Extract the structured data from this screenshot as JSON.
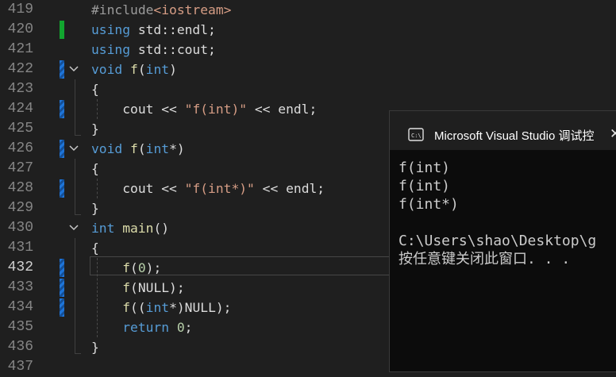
{
  "editor": {
    "lines": [
      {
        "num": "419",
        "tokens": [
          {
            "t": "#include",
            "c": "pp"
          },
          {
            "t": "<iostream>",
            "c": "inc"
          }
        ]
      },
      {
        "num": "420",
        "tokens": [
          {
            "t": "using",
            "c": "kw"
          },
          {
            "t": " std::endl;",
            "c": "plain"
          }
        ]
      },
      {
        "num": "421",
        "tokens": [
          {
            "t": "using",
            "c": "kw"
          },
          {
            "t": " std::cout;",
            "c": "plain"
          }
        ]
      },
      {
        "num": "422",
        "tokens": [
          {
            "t": "void",
            "c": "kw"
          },
          {
            "t": " ",
            "c": "plain"
          },
          {
            "t": "f",
            "c": "fn"
          },
          {
            "t": "(",
            "c": "plain"
          },
          {
            "t": "int",
            "c": "kw"
          },
          {
            "t": ")",
            "c": "plain"
          }
        ]
      },
      {
        "num": "423",
        "tokens": [
          {
            "t": "{",
            "c": "plain"
          }
        ]
      },
      {
        "num": "424",
        "tokens": [
          {
            "t": "    cout << ",
            "c": "plain"
          },
          {
            "t": "\"f(int)\"",
            "c": "str"
          },
          {
            "t": " << endl;",
            "c": "plain"
          }
        ]
      },
      {
        "num": "425",
        "tokens": [
          {
            "t": "}",
            "c": "plain"
          }
        ]
      },
      {
        "num": "426",
        "tokens": [
          {
            "t": "void",
            "c": "kw"
          },
          {
            "t": " ",
            "c": "plain"
          },
          {
            "t": "f",
            "c": "fn"
          },
          {
            "t": "(",
            "c": "plain"
          },
          {
            "t": "int",
            "c": "kw"
          },
          {
            "t": "*)",
            "c": "plain"
          }
        ]
      },
      {
        "num": "427",
        "tokens": [
          {
            "t": "{",
            "c": "plain"
          }
        ]
      },
      {
        "num": "428",
        "tokens": [
          {
            "t": "    cout << ",
            "c": "plain"
          },
          {
            "t": "\"f(int*)\"",
            "c": "str"
          },
          {
            "t": " << endl;",
            "c": "plain"
          }
        ]
      },
      {
        "num": "429",
        "tokens": [
          {
            "t": "}",
            "c": "plain"
          }
        ]
      },
      {
        "num": "430",
        "tokens": [
          {
            "t": "int",
            "c": "kw"
          },
          {
            "t": " ",
            "c": "plain"
          },
          {
            "t": "main",
            "c": "fn"
          },
          {
            "t": "()",
            "c": "plain"
          }
        ]
      },
      {
        "num": "431",
        "tokens": [
          {
            "t": "{",
            "c": "plain"
          }
        ]
      },
      {
        "num": "432",
        "tokens": [
          {
            "t": "    ",
            "c": "plain"
          },
          {
            "t": "f",
            "c": "fn"
          },
          {
            "t": "(",
            "c": "plain"
          },
          {
            "t": "0",
            "c": "num"
          },
          {
            "t": ");",
            "c": "plain"
          }
        ]
      },
      {
        "num": "433",
        "tokens": [
          {
            "t": "    ",
            "c": "plain"
          },
          {
            "t": "f",
            "c": "fn"
          },
          {
            "t": "(NULL);",
            "c": "plain"
          }
        ]
      },
      {
        "num": "434",
        "tokens": [
          {
            "t": "    ",
            "c": "plain"
          },
          {
            "t": "f",
            "c": "fn"
          },
          {
            "t": "((",
            "c": "plain"
          },
          {
            "t": "int",
            "c": "kw"
          },
          {
            "t": "*)NULL);",
            "c": "plain"
          }
        ]
      },
      {
        "num": "435",
        "tokens": [
          {
            "t": "    ",
            "c": "plain"
          },
          {
            "t": "return",
            "c": "kw"
          },
          {
            "t": " ",
            "c": "plain"
          },
          {
            "t": "0",
            "c": "num"
          },
          {
            "t": ";",
            "c": "plain"
          }
        ]
      },
      {
        "num": "436",
        "tokens": [
          {
            "t": "}",
            "c": "plain"
          }
        ]
      },
      {
        "num": "437",
        "tokens": []
      }
    ],
    "active_line": "432",
    "colors": {
      "background": "#1f1f1f",
      "keyword": "#569cd6",
      "function": "#dcdcaa",
      "string": "#d69d85",
      "number": "#b5cea8",
      "change_added": "#12a52f",
      "change_modified": "#1e74d8"
    }
  },
  "console": {
    "tab_icon": "terminal-icon",
    "title": "Microsoft Visual Studio 调试控",
    "close_icon": "close-icon",
    "output": [
      "f(int)",
      "f(int)",
      "f(int*)",
      "",
      "C:\\Users\\shao\\Desktop\\g",
      "按任意键关闭此窗口. . ."
    ]
  }
}
